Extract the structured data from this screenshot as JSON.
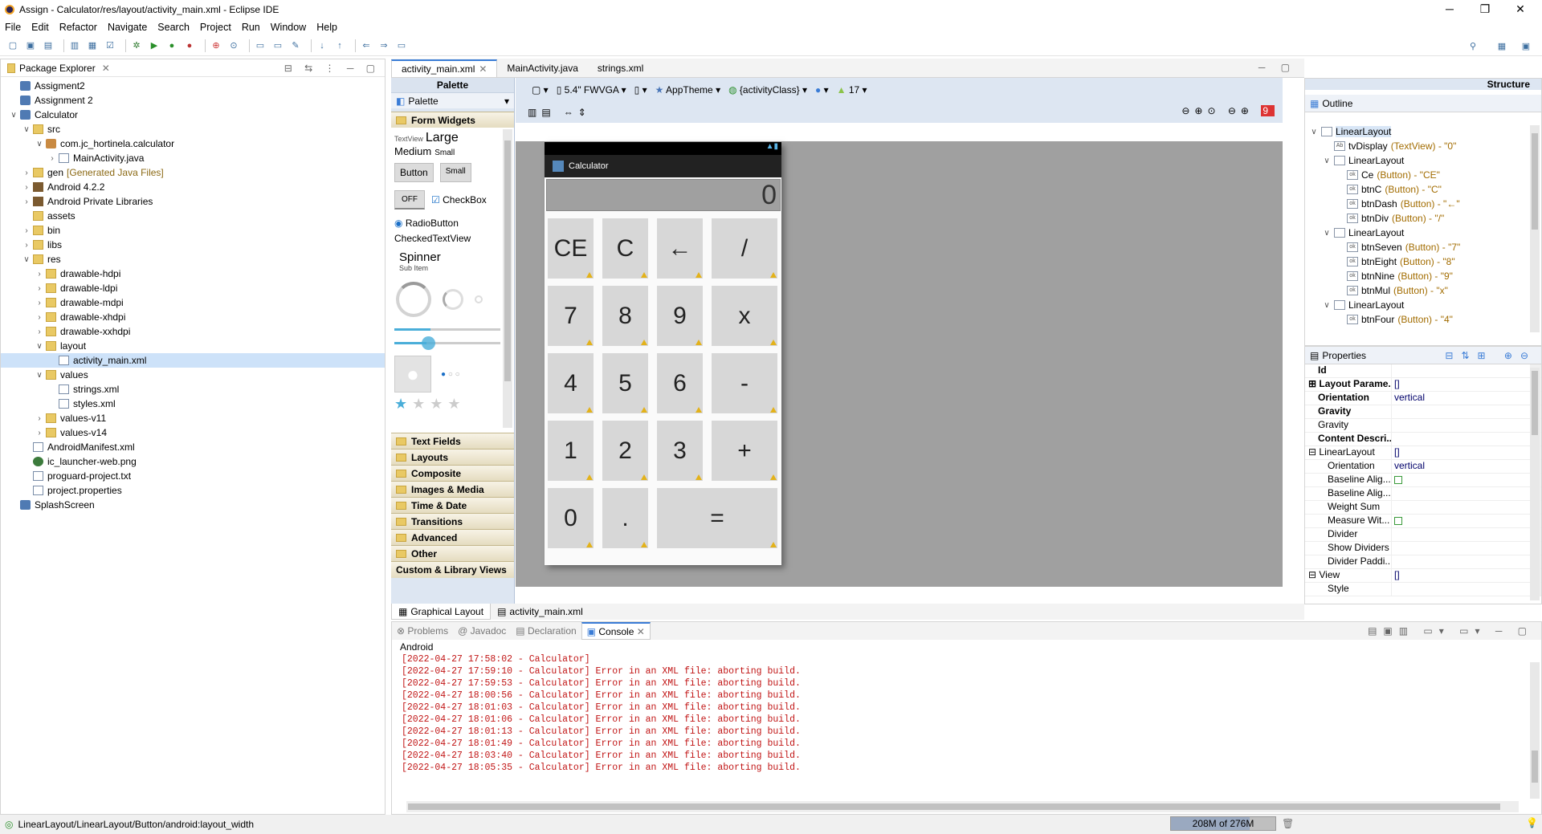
{
  "window": {
    "title": "Assign - Calculator/res/layout/activity_main.xml - Eclipse IDE",
    "minimize": "─",
    "maximize": "❐",
    "close": "✕"
  },
  "menu": [
    "File",
    "Edit",
    "Refactor",
    "Navigate",
    "Search",
    "Project",
    "Run",
    "Window",
    "Help"
  ],
  "package_explorer": {
    "title": "Package Explorer",
    "items": [
      {
        "label": "Assigment2",
        "depth": 0,
        "icon": "proj",
        "tw": ""
      },
      {
        "label": "Assignment 2",
        "depth": 0,
        "icon": "proj",
        "tw": ""
      },
      {
        "label": "Calculator",
        "depth": 0,
        "icon": "proj",
        "tw": "v"
      },
      {
        "label": "src",
        "depth": 1,
        "icon": "fold",
        "tw": "v"
      },
      {
        "label": "com.jc_hortinela.calculator",
        "depth": 2,
        "icon": "pkg",
        "tw": "v"
      },
      {
        "label": "MainActivity.java",
        "depth": 3,
        "icon": "file",
        "tw": ">"
      },
      {
        "label": "gen",
        "extra": "[Generated Java Files]",
        "depth": 1,
        "icon": "fold",
        "tw": ">"
      },
      {
        "label": "Android 4.2.2",
        "depth": 1,
        "icon": "jar",
        "tw": ">"
      },
      {
        "label": "Android Private Libraries",
        "depth": 1,
        "icon": "jar",
        "tw": ">"
      },
      {
        "label": "assets",
        "depth": 1,
        "icon": "fold",
        "tw": ""
      },
      {
        "label": "bin",
        "depth": 1,
        "icon": "fold",
        "tw": ">"
      },
      {
        "label": "libs",
        "depth": 1,
        "icon": "fold",
        "tw": ">"
      },
      {
        "label": "res",
        "depth": 1,
        "icon": "fold",
        "tw": "v"
      },
      {
        "label": "drawable-hdpi",
        "depth": 2,
        "icon": "fold",
        "tw": ">"
      },
      {
        "label": "drawable-ldpi",
        "depth": 2,
        "icon": "fold",
        "tw": ">"
      },
      {
        "label": "drawable-mdpi",
        "depth": 2,
        "icon": "fold",
        "tw": ">"
      },
      {
        "label": "drawable-xhdpi",
        "depth": 2,
        "icon": "fold",
        "tw": ">"
      },
      {
        "label": "drawable-xxhdpi",
        "depth": 2,
        "icon": "fold",
        "tw": ">"
      },
      {
        "label": "layout",
        "depth": 2,
        "icon": "fold",
        "tw": "v"
      },
      {
        "label": "activity_main.xml",
        "depth": 3,
        "icon": "file",
        "tw": "",
        "selected": true
      },
      {
        "label": "values",
        "depth": 2,
        "icon": "fold",
        "tw": "v"
      },
      {
        "label": "strings.xml",
        "depth": 3,
        "icon": "file",
        "tw": ""
      },
      {
        "label": "styles.xml",
        "depth": 3,
        "icon": "file",
        "tw": ""
      },
      {
        "label": "values-v11",
        "depth": 2,
        "icon": "fold",
        "tw": ">"
      },
      {
        "label": "values-v14",
        "depth": 2,
        "icon": "fold",
        "tw": ">"
      },
      {
        "label": "AndroidManifest.xml",
        "depth": 1,
        "icon": "file",
        "tw": ""
      },
      {
        "label": "ic_launcher-web.png",
        "depth": 1,
        "icon": "img",
        "tw": ""
      },
      {
        "label": "proguard-project.txt",
        "depth": 1,
        "icon": "file",
        "tw": ""
      },
      {
        "label": "project.properties",
        "depth": 1,
        "icon": "file",
        "tw": ""
      },
      {
        "label": "SplashScreen",
        "depth": 0,
        "icon": "proj",
        "tw": ""
      }
    ]
  },
  "editor_tabs": [
    "activity_main.xml",
    "MainActivity.java",
    "strings.xml"
  ],
  "palette": {
    "title": "Palette",
    "dropdown": "Palette",
    "section_open": "Form Widgets",
    "textview": "TextView",
    "large": "Large",
    "medium": "Medium",
    "small_text": "Small",
    "button": "Button",
    "small_button": "Small",
    "toggle": "OFF",
    "checkbox": "CheckBox",
    "radio": "RadioButton",
    "checked_tv": "CheckedTextView",
    "spinner": "Spinner",
    "subitem": "Sub Item",
    "sections": [
      "Text Fields",
      "Layouts",
      "Composite",
      "Images & Media",
      "Time & Date",
      "Transitions",
      "Advanced",
      "Other"
    ],
    "custom": "Custom & Library Views"
  },
  "config_bar": {
    "device": "5.4\" FWVGA",
    "theme": "AppTheme",
    "activity": "{activityClass}",
    "api": "17"
  },
  "app": {
    "name": "Calculator",
    "display": "0",
    "rows": [
      [
        "CE",
        "C",
        "←",
        "/"
      ],
      [
        "7",
        "8",
        "9",
        "x"
      ],
      [
        "4",
        "5",
        "6",
        "-"
      ],
      [
        "1",
        "2",
        "3",
        "+"
      ],
      [
        "0",
        ".",
        "="
      ]
    ]
  },
  "bottom_tabs": [
    "Graphical Layout",
    "activity_main.xml"
  ],
  "structure": {
    "title": "Structure",
    "outline_title": "Outline",
    "nodes": [
      {
        "label": "LinearLayout",
        "extra": "",
        "depth": 0,
        "tw": "v",
        "sel": true
      },
      {
        "label": "tvDisplay",
        "extra": "(TextView) - \"0\"",
        "depth": 1,
        "tw": ""
      },
      {
        "label": "LinearLayout",
        "extra": "",
        "depth": 1,
        "tw": "v"
      },
      {
        "label": "Ce",
        "extra": "(Button) - \"CE\"",
        "depth": 2,
        "tw": ""
      },
      {
        "label": "btnC",
        "extra": "(Button) - \"C\"",
        "depth": 2,
        "tw": ""
      },
      {
        "label": "btnDash",
        "extra": "(Button) - \"←\"",
        "depth": 2,
        "tw": ""
      },
      {
        "label": "btnDiv",
        "extra": "(Button) - \"/\"",
        "depth": 2,
        "tw": ""
      },
      {
        "label": "LinearLayout",
        "extra": "",
        "depth": 1,
        "tw": "v"
      },
      {
        "label": "btnSeven",
        "extra": "(Button) - \"7\"",
        "depth": 2,
        "tw": ""
      },
      {
        "label": "btnEight",
        "extra": "(Button) - \"8\"",
        "depth": 2,
        "tw": ""
      },
      {
        "label": "btnNine",
        "extra": "(Button) - \"9\"",
        "depth": 2,
        "tw": ""
      },
      {
        "label": "btnMul",
        "extra": "(Button) - \"x\"",
        "depth": 2,
        "tw": ""
      },
      {
        "label": "LinearLayout",
        "extra": "",
        "depth": 1,
        "tw": "v"
      },
      {
        "label": "btnFour",
        "extra": "(Button) - \"4\"",
        "depth": 2,
        "tw": ""
      }
    ]
  },
  "properties": {
    "title": "Properties",
    "rows": [
      {
        "k": "Id",
        "v": "",
        "bold": true
      },
      {
        "k": "Layout Parame...",
        "v": "[]",
        "bold": true,
        "exp": "+"
      },
      {
        "k": "Orientation",
        "v": "vertical",
        "bold": true
      },
      {
        "k": "Gravity",
        "v": "",
        "bold": true
      },
      {
        "k": "Gravity",
        "v": ""
      },
      {
        "k": "Content Descri...",
        "v": "",
        "bold": true
      },
      {
        "k": "LinearLayout",
        "v": "[]",
        "exp": "-"
      },
      {
        "k": "Orientation",
        "v": "vertical",
        "indent": true
      },
      {
        "k": "Baseline Alig...",
        "v": "",
        "indent": true,
        "cb": true
      },
      {
        "k": "Baseline Alig...",
        "v": "",
        "indent": true
      },
      {
        "k": "Weight Sum",
        "v": "",
        "indent": true
      },
      {
        "k": "Measure Wit...",
        "v": "",
        "indent": true,
        "cb": true
      },
      {
        "k": "Divider",
        "v": "",
        "indent": true
      },
      {
        "k": "Show Dividers",
        "v": "",
        "indent": true
      },
      {
        "k": "Divider Paddi...",
        "v": "",
        "indent": true
      },
      {
        "k": "View",
        "v": "[]",
        "exp": "-"
      },
      {
        "k": "Style",
        "v": "",
        "indent": true
      }
    ]
  },
  "console": {
    "tabs": [
      "Problems",
      "Javadoc",
      "Declaration",
      "Console"
    ],
    "label": "Android",
    "lines": [
      "[2022-04-27 17:58:02 - Calculator]",
      "[2022-04-27 17:59:10 - Calculator] Error in an XML file: aborting build.",
      "[2022-04-27 17:59:53 - Calculator] Error in an XML file: aborting build.",
      "[2022-04-27 18:00:56 - Calculator] Error in an XML file: aborting build.",
      "[2022-04-27 18:01:03 - Calculator] Error in an XML file: aborting build.",
      "[2022-04-27 18:01:06 - Calculator] Error in an XML file: aborting build.",
      "[2022-04-27 18:01:13 - Calculator] Error in an XML file: aborting build.",
      "[2022-04-27 18:01:49 - Calculator] Error in an XML file: aborting build.",
      "[2022-04-27 18:03:40 - Calculator] Error in an XML file: aborting build.",
      "[2022-04-27 18:05:35 - Calculator] Error in an XML file: aborting build."
    ]
  },
  "status": {
    "path": "LinearLayout/LinearLayout/Button/android:layout_width",
    "heap": "208M of 276M",
    "heap_fraction": 0.75
  },
  "colors": {
    "error": "#c11515",
    "accent": "#3a7cd6"
  }
}
